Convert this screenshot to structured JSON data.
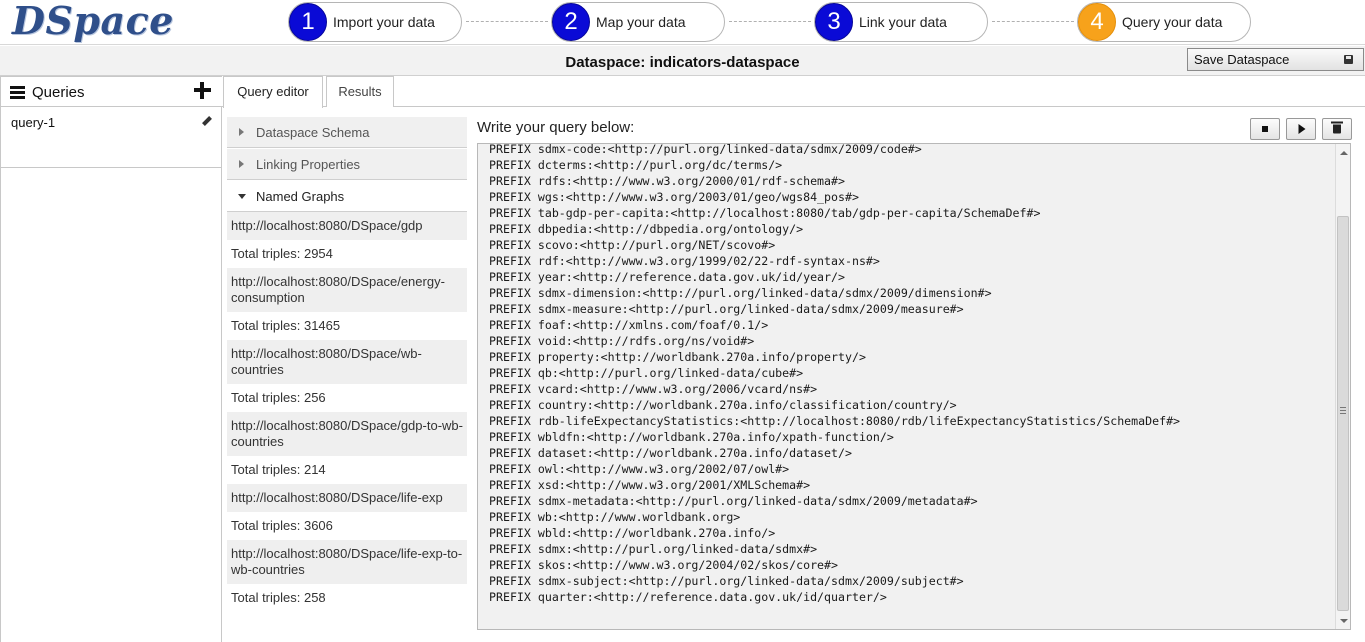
{
  "app": {
    "logo": "DSpace"
  },
  "steps": [
    {
      "number": "1",
      "label": "Import your data",
      "active": false
    },
    {
      "number": "2",
      "label": "Map your data",
      "active": false
    },
    {
      "number": "3",
      "label": "Link your data",
      "active": false
    },
    {
      "number": "4",
      "label": "Query your data",
      "active": true
    }
  ],
  "dataspace": {
    "title": "Dataspace: indicators-dataspace",
    "save_label": "Save Dataspace"
  },
  "sidebar": {
    "title": "Queries",
    "items": [
      {
        "name": "query-1"
      }
    ]
  },
  "tabs": [
    {
      "label": "Query editor",
      "selected": true
    },
    {
      "label": "Results",
      "selected": false
    }
  ],
  "schema_panel": {
    "sections": [
      {
        "label": "Dataspace Schema",
        "open": false
      },
      {
        "label": "Linking Properties",
        "open": false
      },
      {
        "label": "Named Graphs",
        "open": true
      }
    ],
    "graphs": [
      {
        "uri": "http://localhost:8080/DSpace/gdp",
        "triples": "Total triples: 2954"
      },
      {
        "uri": "http://localhost:8080/DSpace/energy-consumption",
        "triples": "Total triples: 31465"
      },
      {
        "uri": "http://localhost:8080/DSpace/wb-countries",
        "triples": "Total triples: 256"
      },
      {
        "uri": "http://localhost:8080/DSpace/gdp-to-wb-countries",
        "triples": "Total triples: 214"
      },
      {
        "uri": "http://localhost:8080/DSpace/life-exp",
        "triples": "Total triples: 3606"
      },
      {
        "uri": "http://localhost:8080/DSpace/life-exp-to-wb-countries",
        "triples": "Total triples: 258"
      }
    ]
  },
  "editor": {
    "label": "Write your query below:",
    "lines": [
      "PREFIX sdmx-code:<http://purl.org/linked-data/sdmx/2009/code#>",
      "PREFIX dcterms:<http://purl.org/dc/terms/>",
      "PREFIX rdfs:<http://www.w3.org/2000/01/rdf-schema#>",
      "PREFIX wgs:<http://www.w3.org/2003/01/geo/wgs84_pos#>",
      "PREFIX tab-gdp-per-capita:<http://localhost:8080/tab/gdp-per-capita/SchemaDef#>",
      "PREFIX dbpedia:<http://dbpedia.org/ontology/>",
      "PREFIX scovo:<http://purl.org/NET/scovo#>",
      "PREFIX rdf:<http://www.w3.org/1999/02/22-rdf-syntax-ns#>",
      "PREFIX year:<http://reference.data.gov.uk/id/year/>",
      "PREFIX sdmx-dimension:<http://purl.org/linked-data/sdmx/2009/dimension#>",
      "PREFIX sdmx-measure:<http://purl.org/linked-data/sdmx/2009/measure#>",
      "PREFIX foaf:<http://xmlns.com/foaf/0.1/>",
      "PREFIX void:<http://rdfs.org/ns/void#>",
      "PREFIX property:<http://worldbank.270a.info/property/>",
      "PREFIX qb:<http://purl.org/linked-data/cube#>",
      "PREFIX vcard:<http://www.w3.org/2006/vcard/ns#>",
      "PREFIX country:<http://worldbank.270a.info/classification/country/>",
      "PREFIX rdb-lifeExpectancyStatistics:<http://localhost:8080/rdb/lifeExpectancyStatistics/SchemaDef#>",
      "PREFIX wbldfn:<http://worldbank.270a.info/xpath-function/>",
      "PREFIX dataset:<http://worldbank.270a.info/dataset/>",
      "PREFIX owl:<http://www.w3.org/2002/07/owl#>",
      "PREFIX xsd:<http://www.w3.org/2001/XMLSchema#>",
      "PREFIX sdmx-metadata:<http://purl.org/linked-data/sdmx/2009/metadata#>",
      "PREFIX wb:<http://www.worldbank.org>",
      "PREFIX wbld:<http://worldbank.270a.info/>",
      "PREFIX sdmx:<http://purl.org/linked-data/sdmx#>",
      "PREFIX skos:<http://www.w3.org/2004/02/skos/core#>",
      "PREFIX sdmx-subject:<http://purl.org/linked-data/sdmx/2009/subject#>",
      "PREFIX quarter:<http://reference.data.gov.uk/id/quarter/>"
    ]
  },
  "icons": {
    "stop": "stop-icon",
    "run": "play-icon",
    "clear": "trash-icon",
    "save": "floppy-icon",
    "menu": "hamburger-icon",
    "add": "plus-icon",
    "edit": "pencil-icon"
  },
  "colors": {
    "step_blue": "#0a0ad6",
    "step_active": "#f7a21b",
    "logo": "#2f4f8a"
  }
}
